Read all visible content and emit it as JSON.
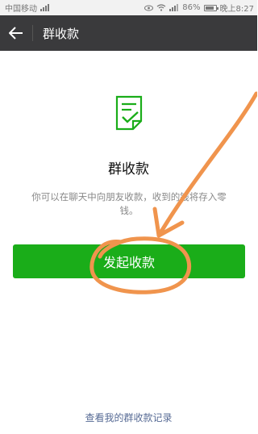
{
  "status_bar": {
    "carrier": "中国移动",
    "battery": "86%",
    "time": "晚上8:27",
    "battery_level": 0.86
  },
  "nav": {
    "back_icon": "arrow-left-icon",
    "title": "群收款"
  },
  "main": {
    "icon": "document-check-icon",
    "title": "群收款",
    "description": "你可以在聊天中向朋友收款，收到的钱将存入零钱。",
    "button_label": "发起收款",
    "history_link": "查看我的群收款记录"
  },
  "colors": {
    "accent_green": "#1aad19",
    "nav_bg": "#3a3a3c",
    "link_blue": "#576b95",
    "annotation_orange": "#f0944d"
  }
}
